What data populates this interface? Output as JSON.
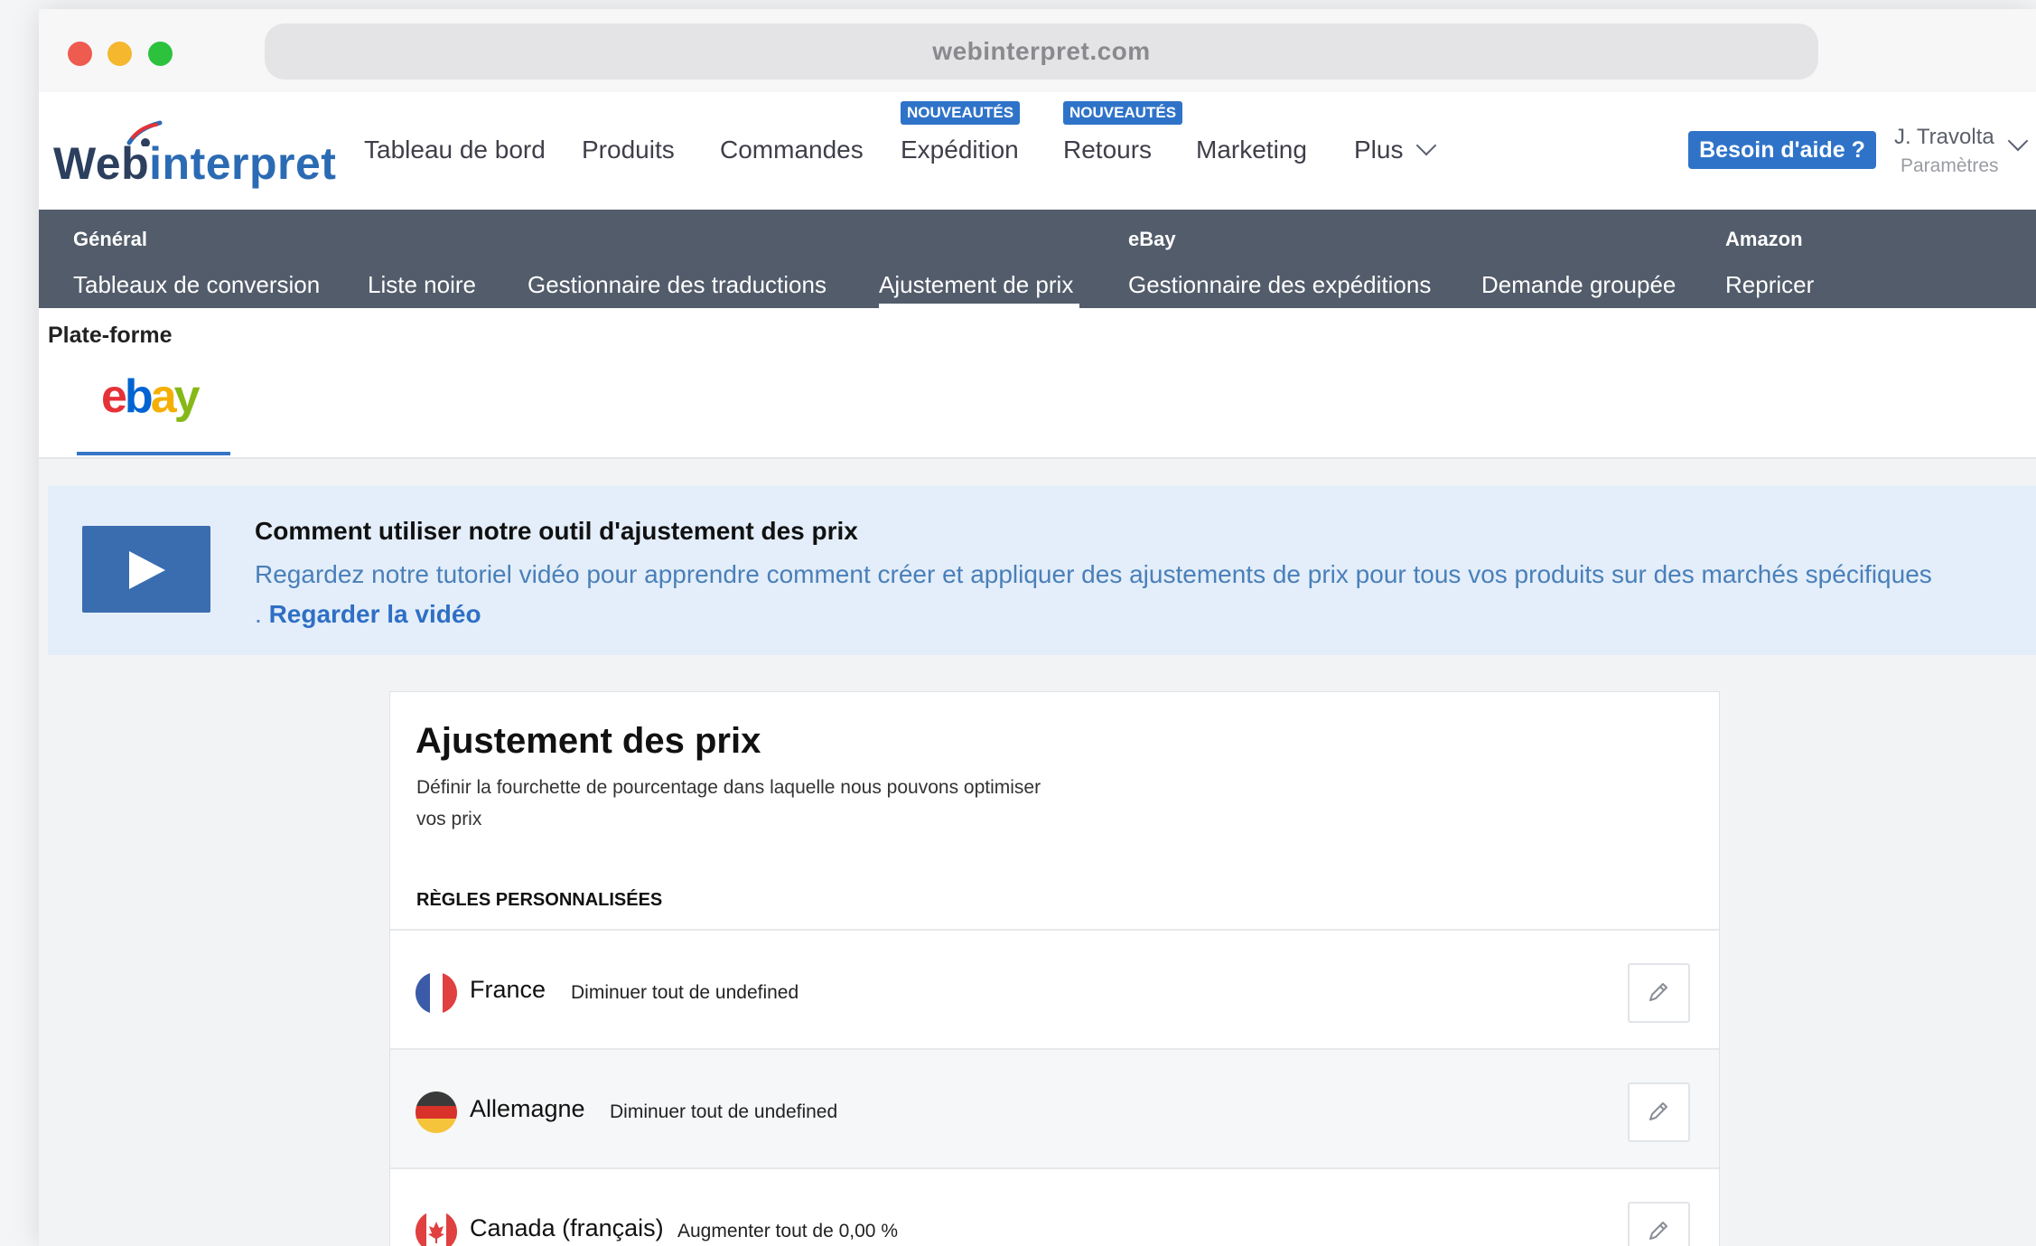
{
  "browser": {
    "url": "webinterpret.com"
  },
  "brand": {
    "logo_part1": "Web",
    "logo_part2": "interpret",
    "primary_color": "#2f73c9",
    "subnav_color": "#525c6a"
  },
  "topnav": {
    "items": [
      {
        "label": "Tableau de bord"
      },
      {
        "label": "Produits"
      },
      {
        "label": "Commandes"
      },
      {
        "label": "Expédition",
        "badge": "NOUVEAUTÉS"
      },
      {
        "label": "Retours",
        "badge": "NOUVEAUTÉS"
      },
      {
        "label": "Marketing"
      },
      {
        "label": "Plus"
      }
    ],
    "help_label": "Besoin d'aide ?",
    "user_name": "J. Travolta",
    "user_settings": "Paramètres"
  },
  "subnav": {
    "groups": [
      "Général",
      "eBay",
      "Amazon"
    ],
    "items": [
      {
        "label": "Tableaux de conversion"
      },
      {
        "label": "Liste noire"
      },
      {
        "label": "Gestionnaire des traductions"
      },
      {
        "label": "Ajustement de prix",
        "active": true
      },
      {
        "label": "Gestionnaire des expéditions"
      },
      {
        "label": "Demande groupée"
      },
      {
        "label": "Repricer"
      }
    ]
  },
  "platform": {
    "label": "Plate-forme",
    "tabs": [
      {
        "name": "ebay",
        "letters": [
          "e",
          "b",
          "a",
          "y"
        ],
        "colors": [
          "#e53238",
          "#0064d2",
          "#f5af02",
          "#86b817"
        ],
        "active": true
      }
    ]
  },
  "banner": {
    "title": "Comment utiliser notre outil d'ajustement des prix",
    "text": "Regardez notre tutoriel vidéo pour apprendre comment créer et appliquer des ajustements de prix pour tous vos produits sur des marchés spécifiques . ",
    "link": "Regarder la vidéo",
    "icon": "play-icon"
  },
  "card": {
    "title": "Ajustement des prix",
    "description": "Définir la fourchette de pourcentage dans laquelle nous pouvons optimiser vos prix",
    "rules_label": "RÈGLES PERSONNALISÉES",
    "rules": [
      {
        "country": "France",
        "rule": "Diminuer tout de undefined",
        "flag": "france-flag-icon"
      },
      {
        "country": "Allemagne",
        "rule": "Diminuer tout de undefined",
        "flag": "germany-flag-icon"
      },
      {
        "country": "Canada (français)",
        "rule": "Augmenter tout de 0,00 %",
        "flag": "canada-flag-icon"
      }
    ]
  }
}
